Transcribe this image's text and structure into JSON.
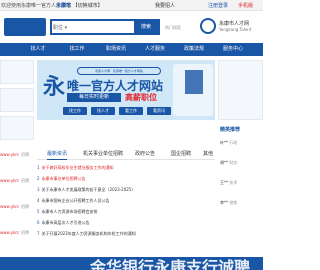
{
  "topbar": {
    "welcome": "欢迎使用永康唯一官方人才网站",
    "city_label": "永康市",
    "city_switch": "【切换城市】",
    "login": "我要招人",
    "register": "注册登录",
    "mobile": "手机版"
  },
  "header": {
    "search_drop": "职位 ▾",
    "search_button": "搜索",
    "hot_words": "热门搜索",
    "logo_title": "永康市人才网",
    "logo_sub": "Yongkang Talent"
  },
  "nav": {
    "items": [
      "找人才",
      "找工作",
      "职场资讯",
      "人才服务",
      "政策法规",
      "服务中心"
    ]
  },
  "left": {
    "rows": [
      {
        "label": "www.ykrc",
        "tag": "招聘"
      },
      {
        "label": "www.ykrc",
        "tag": "招聘"
      },
      {
        "label": "www.ykrc",
        "tag": "招聘"
      },
      {
        "label": "www.ykrc",
        "tag": "招聘"
      }
    ]
  },
  "banner": {
    "big_char": "永",
    "headline": "唯一官方人才网站",
    "pill": "永康人才网 · 永康唯一官方人才网站",
    "sub": "每日实时更新",
    "sub2": "高薪职位",
    "buttons": [
      "找工作",
      "找人才",
      "看工作",
      "看资讯"
    ]
  },
  "tabs": {
    "items": [
      "最新资讯",
      "机关事业单位招聘",
      "政府公告",
      "国企招聘",
      "其他"
    ]
  },
  "news": {
    "items": [
      "关于做好高校毕业生就业服务工作的通知",
      "永康市事业单位招聘公告",
      "关于永康市人才发展政策的若干意见（2023-2025）",
      "永康市国有企业公开招聘工作人员公告",
      "永康市人力资源市场招聘会安排",
      "永康市高层次人才引进公告",
      "关于开展2023年度人力资源服务机构年检工作的通知"
    ]
  },
  "right": {
    "title": "精英推荐",
    "people": [
      {
        "name": "叶**",
        "role": "行政"
      },
      {
        "name": "胡**",
        "role": "财务"
      },
      {
        "name": "王**",
        "role": "技术"
      },
      {
        "name": "李**",
        "role": "销售"
      }
    ]
  },
  "bottom": {
    "text": "金华银行永康支行诚聘"
  },
  "colors": {
    "brand": "#1a56a6",
    "accent": "#e0252b",
    "banner_bg": "#cfe7f6"
  }
}
